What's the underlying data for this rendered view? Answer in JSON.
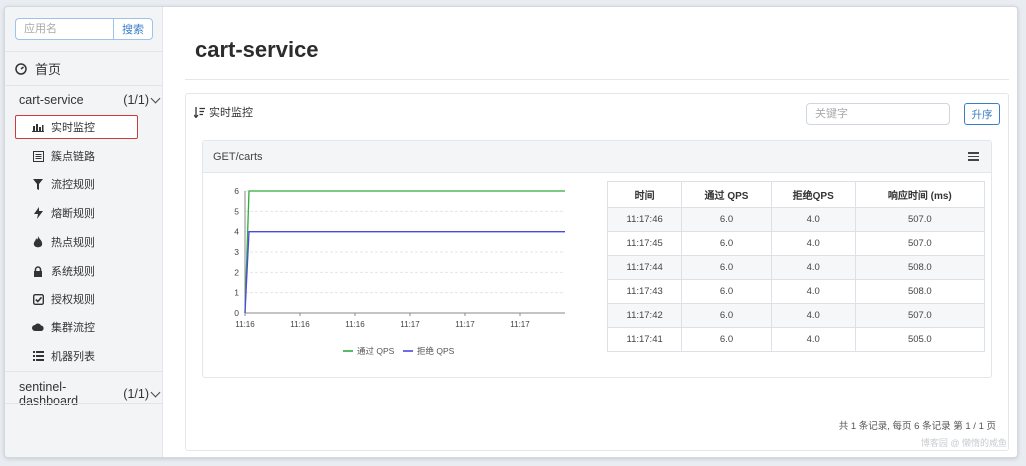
{
  "sidebar": {
    "search_placeholder": "应用名",
    "search_button": "搜索",
    "home_label": "首页",
    "apps": [
      {
        "name": "cart-service",
        "count": "(1/1)"
      },
      {
        "name": "sentinel-dashboard",
        "count": "(1/1)"
      }
    ],
    "menu": [
      {
        "label": "实时监控",
        "icon": "bar-chart-icon"
      },
      {
        "label": "簇点链路",
        "icon": "list-box-icon"
      },
      {
        "label": "流控规则",
        "icon": "filter-icon"
      },
      {
        "label": "熔断规则",
        "icon": "lightning-icon"
      },
      {
        "label": "热点规则",
        "icon": "fire-icon"
      },
      {
        "label": "系统规则",
        "icon": "lock-icon"
      },
      {
        "label": "授权规则",
        "icon": "check-square-icon"
      },
      {
        "label": "集群流控",
        "icon": "cloud-icon"
      },
      {
        "label": "机器列表",
        "icon": "list-icon"
      }
    ]
  },
  "main": {
    "title": "cart-service",
    "panel_title": "实时监控",
    "keyword_placeholder": "关键字",
    "sort_button": "升序",
    "resource_name": "GET/carts",
    "pager": "共 1 条记录, 每页 6 条记录 第 1 / 1 页",
    "watermark": "博客园 @ 懒惰的咸鱼"
  },
  "chart_data": {
    "type": "line",
    "x": [
      "11:16",
      "11:16",
      "11:16",
      "11:17",
      "11:17",
      "11:17"
    ],
    "ylim": [
      0,
      6
    ],
    "yticks": [
      0,
      1,
      2,
      3,
      4,
      5,
      6
    ],
    "series": [
      {
        "name": "通过 QPS",
        "color": "#2eaa3c",
        "values": [
          0,
          6,
          6,
          6,
          6,
          6,
          6
        ]
      },
      {
        "name": "拒绝 QPS",
        "color": "#4a4adb",
        "values": [
          0,
          4,
          4,
          4,
          4,
          4,
          4
        ]
      }
    ]
  },
  "table": {
    "headers": [
      "时间",
      "通过 QPS",
      "拒绝QPS",
      "响应时间 (ms)"
    ],
    "rows": [
      [
        "11:17:46",
        "6.0",
        "4.0",
        "507.0"
      ],
      [
        "11:17:45",
        "6.0",
        "4.0",
        "507.0"
      ],
      [
        "11:17:44",
        "6.0",
        "4.0",
        "508.0"
      ],
      [
        "11:17:43",
        "6.0",
        "4.0",
        "508.0"
      ],
      [
        "11:17:42",
        "6.0",
        "4.0",
        "507.0"
      ],
      [
        "11:17:41",
        "6.0",
        "4.0",
        "505.0"
      ]
    ]
  }
}
